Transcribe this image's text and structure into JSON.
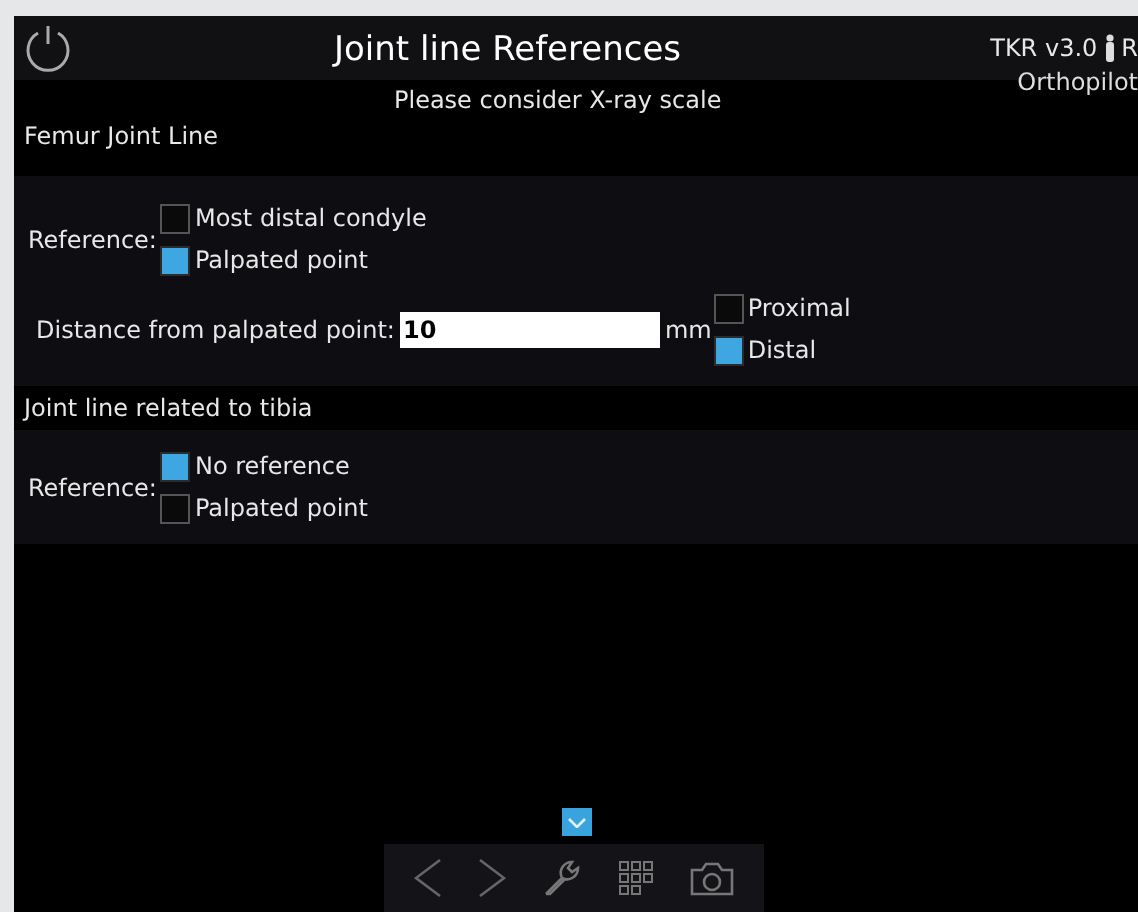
{
  "header": {
    "title": "Joint line References",
    "version": "TKR v3.0",
    "version_suffix": "R",
    "product": "Orthopilot"
  },
  "notice": "Please consider X-ray scale",
  "femur": {
    "title": "Femur Joint Line",
    "reference_label": "Reference:",
    "options": [
      {
        "label": "Most distal condyle",
        "checked": false
      },
      {
        "label": "Palpated point",
        "checked": true
      }
    ],
    "distance": {
      "label": "Distance from palpated point:",
      "value": "10",
      "unit": "mm",
      "options": [
        {
          "label": "Proximal",
          "checked": false
        },
        {
          "label": "Distal",
          "checked": true
        }
      ]
    }
  },
  "tibia": {
    "title": "Joint line related to tibia",
    "reference_label": "Reference:",
    "options": [
      {
        "label": "No reference",
        "checked": true
      },
      {
        "label": "Palpated point",
        "checked": false
      }
    ]
  },
  "toolbar": {
    "expanded": false
  }
}
